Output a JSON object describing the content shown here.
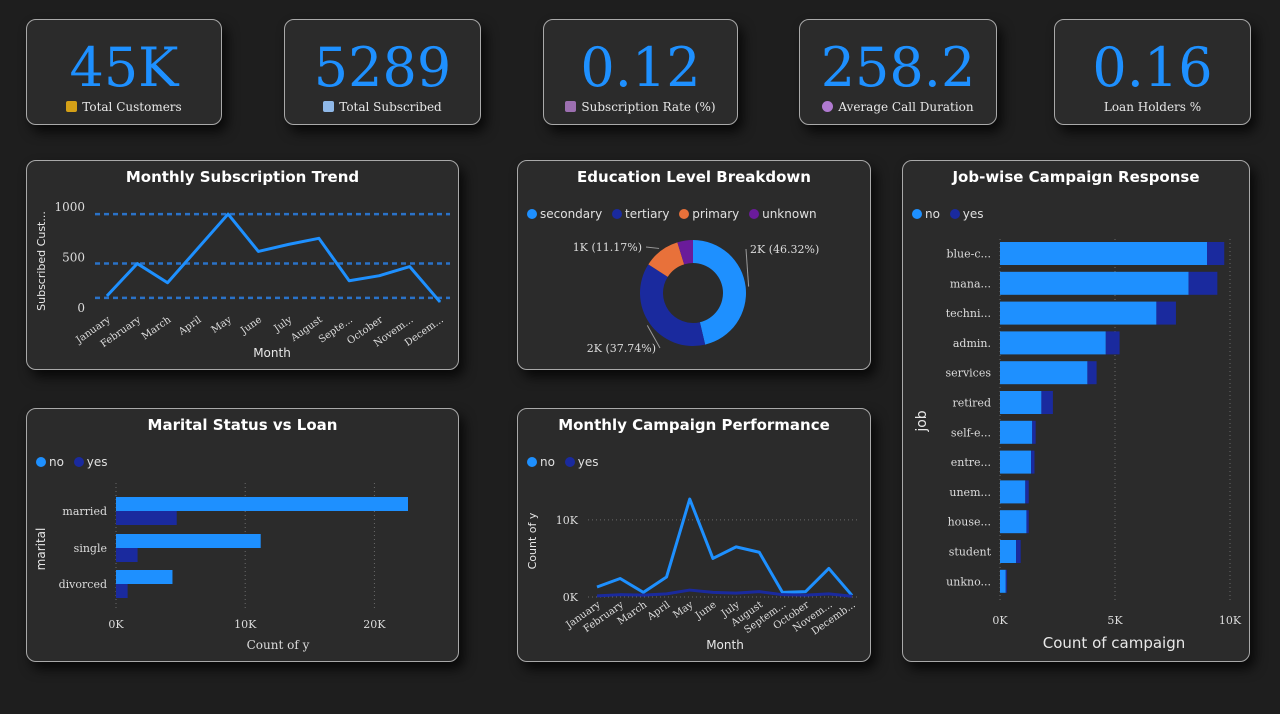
{
  "colors": {
    "bg": "#1e1e1e",
    "card": "#2b2b2b",
    "accent": "#1e90ff",
    "no": "#1e90ff",
    "yes": "#1a2a9e",
    "primary": "#e8713a",
    "unknown": "#6a1b9a",
    "trendline": "#2a72c8"
  },
  "kpis": [
    {
      "value": "45K",
      "label": "Total Customers",
      "icon": "person-icon",
      "icon_color": "#d4a017"
    },
    {
      "value": "5289",
      "label": "Total Subscribed",
      "icon": "chart-icon",
      "icon_color": "#8fb8e8"
    },
    {
      "value": "0.12",
      "label": "Subscription Rate (%)",
      "icon": "bar-chart-icon",
      "icon_color": "#9c6fb0"
    },
    {
      "value": "258.2",
      "label": "Average Call Duration",
      "icon": "timer-icon",
      "icon_color": "#b07ad0"
    },
    {
      "value": "0.16",
      "label": "Loan Holders %",
      "icon": "",
      "icon_color": ""
    }
  ],
  "chart_data": [
    {
      "id": "trend",
      "type": "line",
      "title": "Monthly Subscription Trend",
      "xlabel": "Month",
      "ylabel": "Subscribed Cust...",
      "categories": [
        "January",
        "February",
        "March",
        "April",
        "May",
        "June",
        "July",
        "August",
        "Septe...",
        "October",
        "Novem...",
        "Decem..."
      ],
      "series": [
        {
          "values": [
            120,
            440,
            250,
            590,
            930,
            560,
            630,
            690,
            270,
            320,
            410,
            60
          ]
        }
      ],
      "yticks": [
        "0",
        "500",
        "1000"
      ],
      "ylim": [
        0,
        1000
      ],
      "reference_lines": [
        100,
        440,
        930
      ]
    },
    {
      "id": "education",
      "type": "pie",
      "title": "Education Level Breakdown",
      "legend": [
        "secondary",
        "tertiary",
        "primary",
        "unknown"
      ],
      "values": [
        46.32,
        37.74,
        11.17,
        4.77
      ],
      "labels": [
        "2K (46.32%)",
        "2K (37.74%)",
        "1K (11.17%)",
        ""
      ],
      "colors": [
        "#1e90ff",
        "#1a2a9e",
        "#e8713a",
        "#6a1b9a"
      ]
    },
    {
      "id": "job",
      "type": "bar",
      "title": "Job-wise Campaign Response",
      "legend": [
        "no",
        "yes"
      ],
      "xlabel": "Count of campaign",
      "ylabel": "job",
      "categories": [
        "blue-c...",
        "mana...",
        "techni...",
        "admin.",
        "services",
        "retired",
        "self-e...",
        "entre...",
        "unem...",
        "house...",
        "student",
        "unkno..."
      ],
      "series": [
        {
          "name": "no",
          "values": [
            9000,
            8200,
            6800,
            4600,
            3800,
            1800,
            1400,
            1350,
            1100,
            1150,
            700,
            250
          ]
        },
        {
          "name": "yes",
          "values": [
            750,
            1250,
            850,
            600,
            400,
            500,
            150,
            150,
            150,
            100,
            200,
            50
          ]
        }
      ],
      "xticks": [
        "0K",
        "5K",
        "10K"
      ],
      "xlim": [
        0,
        10000
      ]
    },
    {
      "id": "marital",
      "type": "bar",
      "title": "Marital Status vs Loan",
      "legend": [
        "no",
        "yes"
      ],
      "xlabel": "Count of y",
      "ylabel": "marital",
      "categories": [
        "married",
        "single",
        "divorced"
      ],
      "series": [
        {
          "name": "no",
          "values": [
            22600,
            11200,
            4370
          ]
        },
        {
          "name": "yes",
          "values": [
            4700,
            1670,
            900
          ]
        }
      ],
      "xticks": [
        "0K",
        "10K",
        "20K"
      ],
      "xlim": [
        0,
        22600
      ]
    },
    {
      "id": "campaign",
      "type": "line",
      "title": "Monthly Campaign Performance",
      "legend": [
        "no",
        "yes"
      ],
      "xlabel": "Month",
      "ylabel": "Count of y",
      "categories": [
        "January",
        "February",
        "March",
        "April",
        "May",
        "June",
        "July",
        "August",
        "Septem...",
        "October",
        "Novem...",
        "Decemb..."
      ],
      "series": [
        {
          "name": "no",
          "values": [
            1300,
            2400,
            600,
            2600,
            12700,
            5000,
            6500,
            5800,
            600,
            700,
            3700,
            200
          ]
        },
        {
          "name": "yes",
          "values": [
            150,
            300,
            250,
            400,
            900,
            600,
            500,
            700,
            300,
            250,
            400,
            100
          ]
        }
      ],
      "yticks": [
        "0K",
        "10K"
      ],
      "ylim": [
        0,
        14000
      ]
    }
  ]
}
